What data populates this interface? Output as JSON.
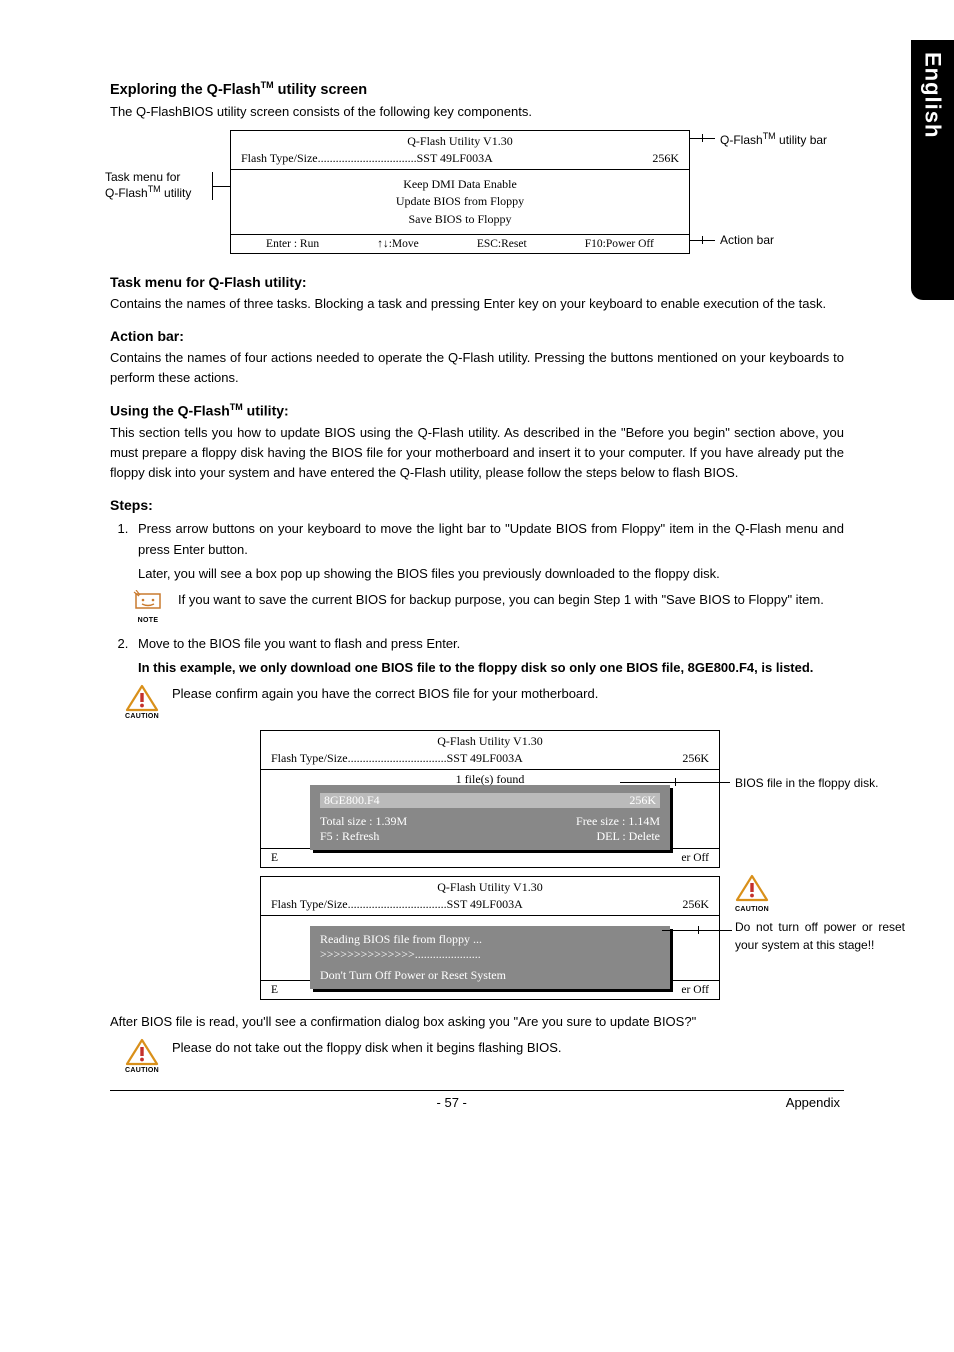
{
  "sideTab": "English",
  "heading1": "Exploring the Q-Flash",
  "heading1_suffix": " utility screen",
  "intro1": "The Q-FlashBIOS utility screen consists of the following key components.",
  "fig1": {
    "title": "Q-Flash Utility V1.30",
    "flash_left": "Flash Type/Size.................................SST 49LF003A",
    "flash_right": "256K",
    "menu1": "Keep DMI Data     Enable",
    "menu2": "Update BIOS from Floppy",
    "menu3": "Save BIOS to Floppy",
    "action_enter": "Enter : Run",
    "action_move": "↑↓:Move",
    "action_esc": "ESC:Reset",
    "action_f10": "F10:Power Off",
    "callout_left1": "Task menu for",
    "callout_left2": "Q-Flash",
    "callout_left2_suffix": " utility",
    "callout_right_top": "Q-Flash",
    "callout_right_top_suffix": " utility bar",
    "callout_right_bottom": "Action bar"
  },
  "h_task": "Task menu for Q-Flash utility:",
  "p_task": "Contains the names of three tasks. Blocking a task and pressing Enter key on your keyboard to enable execution of the task.",
  "h_action": "Action bar:",
  "p_action": "Contains the names of four actions needed to operate the Q-Flash utility. Pressing the buttons mentioned on your keyboards to perform these actions.",
  "h_using": "Using the Q-Flash",
  "h_using_suffix": " utility:",
  "p_using": "This section tells you how to update BIOS using the Q-Flash utility. As described in the \"Before you begin\" section above, you must prepare a floppy disk having the BIOS file for your motherboard and insert it to your computer. If you have already put the floppy disk into your system and have entered the Q-Flash utility, please follow the steps below to flash BIOS.",
  "h_steps": "Steps:",
  "step1": "Press arrow buttons on your keyboard to move the light bar to \"Update BIOS from Floppy\" item in the Q-Flash menu and press Enter button.",
  "step1b": "Later, you will see a box pop up showing the BIOS files you previously downloaded to the floppy disk.",
  "note1": "If you want to save the current BIOS for backup purpose, you can begin Step 1 with \"Save BIOS to Floppy\" item.",
  "note1_label": "NOTE",
  "step2": "Move to the BIOS file you want to flash and press Enter.",
  "step2_bold": "In this example, we only download one BIOS file to the floppy disk so only one BIOS file, 8GE800.F4, is listed.",
  "caution1": "Please confirm again you have the correct BIOS file for your motherboard.",
  "caution_label": "CAUTION",
  "fig2": {
    "title": "Q-Flash Utility V1.30",
    "flash_left": "Flash Type/Size.................................SST 49LF003A",
    "flash_right": "256K",
    "files_found": "1 file(s) found",
    "bios_name": "8GE800.F4",
    "bios_size": "256K",
    "total": "Total size : 1.39M",
    "free": "Free size : 1.14M",
    "f5": "F5 : Refresh",
    "del": "DEL : Delete",
    "action_e_l": "E",
    "action_e_r": "er Off",
    "side_label": "BIOS file in the floppy disk."
  },
  "fig3": {
    "title": "Q-Flash Utility V1.30",
    "flash_left": "Flash Type/Size.................................SST 49LF003A",
    "flash_right": "256K",
    "reading": "Reading BIOS file from floppy ...",
    "progress": ">>>>>>>>>>>>>>......................",
    "warn": "Don't Turn Off Power or Reset System",
    "action_e_l": "E",
    "action_e_r": "er Off",
    "side_caution": "Do not turn off power or reset your system at this stage!!"
  },
  "after_text": "After BIOS file is read, you'll see a confirmation dialog box asking you \"Are you sure to update BIOS?\"",
  "caution2": "Please do not take out the floppy disk when it begins flashing BIOS.",
  "footer_page": "- 57 -",
  "footer_right": "Appendix"
}
